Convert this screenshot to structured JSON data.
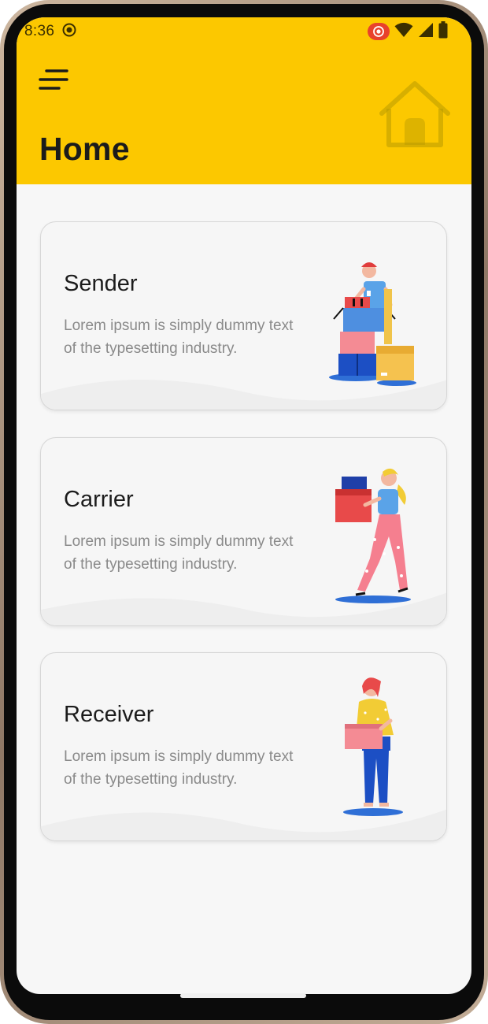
{
  "status_bar": {
    "time": "8:36",
    "icons": [
      "screen-record-icon",
      "recording-badge-icon",
      "wifi-icon",
      "cellular-signal-icon",
      "battery-icon"
    ]
  },
  "header": {
    "title": "Home",
    "menu_icon": "menu-icon",
    "decor_icon": "house-icon",
    "background_color": "#fcc800"
  },
  "cards": [
    {
      "title": "Sender",
      "description": "Lorem ipsum is simply dummy text of the typesetting industry."
    },
    {
      "title": "Carrier",
      "description": "Lorem ipsum is simply dummy text of the typesetting industry."
    },
    {
      "title": "Receiver",
      "description": "Lorem ipsum is simply dummy text of the typesetting industry."
    }
  ],
  "colors": {
    "accent": "#fcc800",
    "card_background": "#f6f6f6",
    "title_text": "#1c1c1c",
    "description_text": "#8a8a8a"
  }
}
